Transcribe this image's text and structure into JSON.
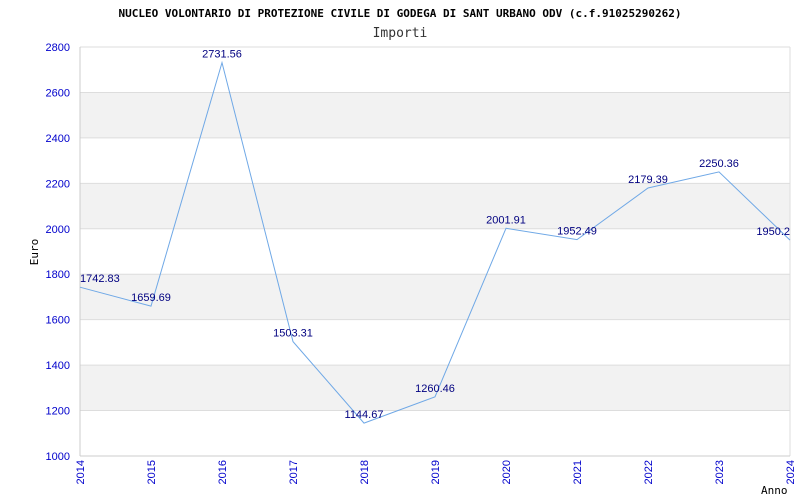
{
  "chart_data": {
    "type": "line",
    "title": "NUCLEO VOLONTARIO DI PROTEZIONE CIVILE DI GODEGA DI SANT URBANO ODV (c.f.91025290262)",
    "subtitle": "Importi",
    "xlabel": "Anno",
    "ylabel": "Euro",
    "categories": [
      "2014",
      "2015",
      "2016",
      "2017",
      "2018",
      "2019",
      "2020",
      "2021",
      "2022",
      "2023",
      "2024"
    ],
    "values": [
      1742.83,
      1659.69,
      2731.56,
      1503.31,
      1144.67,
      1260.46,
      2001.91,
      1952.49,
      2179.39,
      2250.36,
      1950.2
    ],
    "value_labels": [
      "1742.83",
      "1659.69",
      "2731.56",
      "1503.31",
      "1144.67",
      "1260.46",
      "2001.91",
      "1952.49",
      "2179.39",
      "2250.36",
      "1950.2"
    ],
    "yticks": [
      "1000",
      "1200",
      "1400",
      "1600",
      "1800",
      "2000",
      "2200",
      "2400",
      "2600",
      "2800"
    ],
    "ylim": [
      1000,
      2800
    ],
    "grid": true,
    "colors": {
      "line": "#6fa8e6",
      "band": "#f2f2f2",
      "gridline": "#dddddd",
      "tick_text": "#0000cc",
      "label_text": "#000080"
    }
  }
}
